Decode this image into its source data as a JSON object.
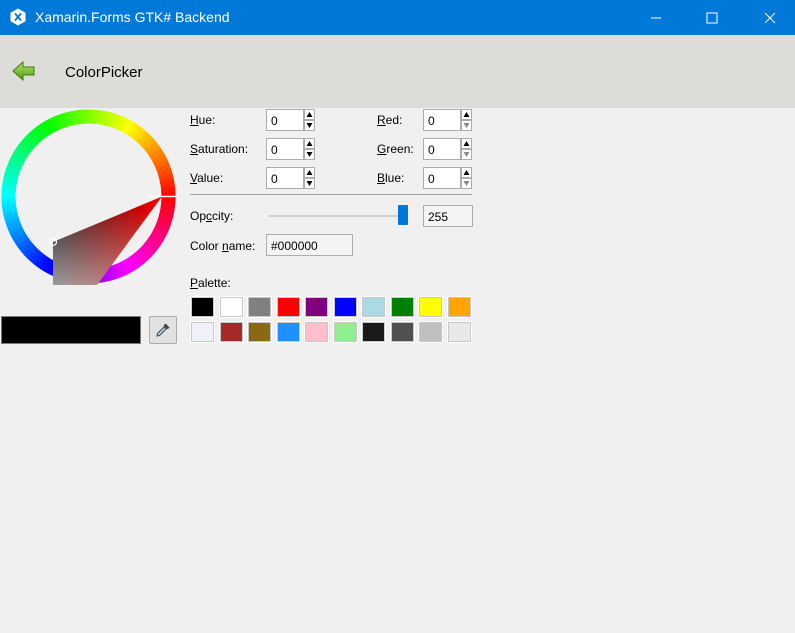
{
  "window": {
    "title": "Xamarin.Forms GTK# Backend",
    "accent_color": "#0078d7"
  },
  "navbar": {
    "title": "ColorPicker",
    "back_icon": "green-left-arrow-icon"
  },
  "hsv": {
    "hue_label": "Hue:",
    "hue_value": "0",
    "saturation_label": "Saturation:",
    "saturation_value": "0",
    "value_label": "Value:",
    "value_value": "0"
  },
  "rgb": {
    "red_label": "Red:",
    "red_value": "0",
    "green_label": "Green:",
    "green_value": "0",
    "blue_label": "Blue:",
    "blue_value": "0"
  },
  "opacity": {
    "label": "Opacity:",
    "value": "255",
    "level": 1.0
  },
  "color_name": {
    "label": "Color name:",
    "value": "#000000"
  },
  "palette": {
    "label": "Palette:",
    "swatches": [
      "#000000",
      "#ffffff",
      "#808080",
      "#ff0000",
      "#800080",
      "#0000ff",
      "#add8e6",
      "#008000",
      "#ffff00",
      "#ffa500",
      "#f0f0f8",
      "#a52a2a",
      "#8b6914",
      "#1e90ff",
      "#ffc0cb",
      "#90ee90",
      "#1a1a1a",
      "#505050",
      "#c0c0c0",
      "#e8e8e8"
    ]
  },
  "current_color": "#000000",
  "dropper_icon": "eyedropper-icon"
}
